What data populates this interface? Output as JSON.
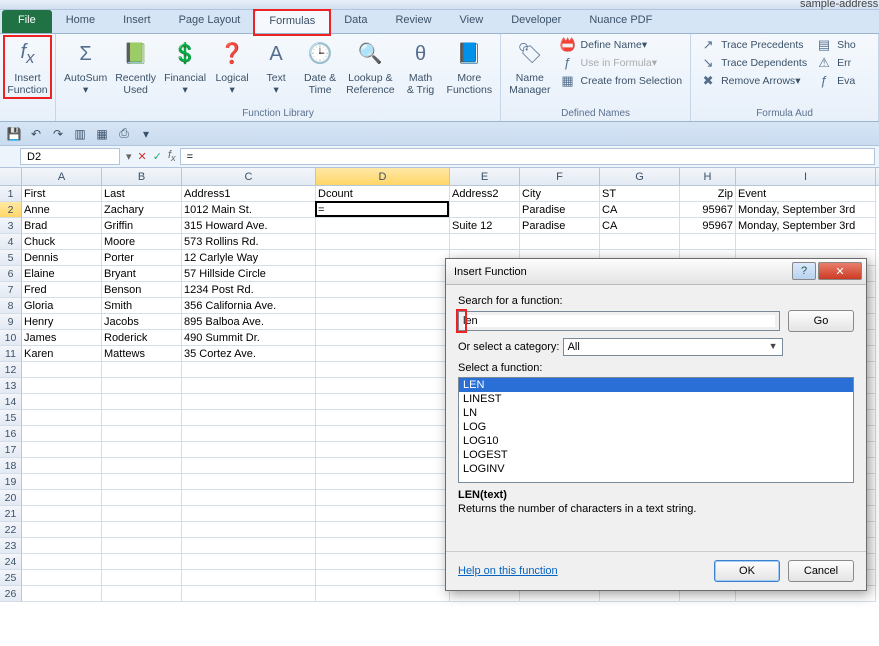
{
  "window": {
    "title": "sample-address"
  },
  "tabs": [
    "File",
    "Home",
    "Insert",
    "Page Layout",
    "Formulas",
    "Data",
    "Review",
    "View",
    "Developer",
    "Nuance PDF"
  ],
  "active_tab": 4,
  "highlight_tab": 4,
  "ribbon": {
    "insert_function": "Insert\nFunction",
    "autosum": "AutoSum",
    "recently": "Recently\nUsed",
    "financial": "Financial",
    "logical": "Logical",
    "text": "Text",
    "date": "Date &\nTime",
    "lookup": "Lookup &\nReference",
    "math": "Math\n& Trig",
    "more": "More\nFunctions",
    "flib": "Function Library",
    "name_mgr": "Name\nManager",
    "def_name": "Define Name",
    "use_form": "Use in Formula",
    "create_sel": "Create from Selection",
    "def_names": "Defined Names",
    "trace_prec": "Trace Precedents",
    "trace_dep": "Trace Dependents",
    "remove_arr": "Remove Arrows",
    "show": "Sho",
    "err": "Err",
    "eval": "Eva",
    "faud": "Formula Aud"
  },
  "namebox": "D2",
  "formula": "=",
  "cols": [
    "A",
    "B",
    "C",
    "D",
    "E",
    "F",
    "G",
    "H",
    "I"
  ],
  "headers": [
    "First",
    "Last",
    "Address1",
    "Dcount",
    "Address2",
    "City",
    "ST",
    "Zip",
    "Event"
  ],
  "rows": [
    [
      "Anne",
      "Zachary",
      "1012 Main St.",
      "=",
      "",
      "Paradise",
      "CA",
      "95967",
      "Monday, September 3rd"
    ],
    [
      "Brad",
      "Griffin",
      "315 Howard Ave.",
      "",
      "Suite 12",
      "Paradise",
      "CA",
      "95967",
      "Monday, September 3rd"
    ],
    [
      "Chuck",
      "Moore",
      "573 Rollins Rd.",
      "",
      "",
      "",
      "",
      "",
      ""
    ],
    [
      "Dennis",
      "Porter",
      "12 Carlyle Way",
      "",
      "",
      "",
      "",
      "",
      ""
    ],
    [
      "Elaine",
      "Bryant",
      "57 Hillside Circle",
      "",
      "",
      "",
      "",
      "",
      ""
    ],
    [
      "Fred",
      "Benson",
      "1234 Post Rd.",
      "",
      "",
      "",
      "",
      "",
      ""
    ],
    [
      "Gloria",
      "Smith",
      "356 California Ave.",
      "",
      "",
      "",
      "",
      "",
      ""
    ],
    [
      "Henry",
      "Jacobs",
      "895 Balboa Ave.",
      "",
      "",
      "",
      "",
      "",
      ""
    ],
    [
      "James",
      "Roderick",
      "490 Summit Dr.",
      "",
      "",
      "",
      "",
      "",
      ""
    ],
    [
      "Karen",
      "Mattews",
      "35 Cortez Ave.",
      "",
      "",
      "",
      "",
      "",
      ""
    ]
  ],
  "blank_rows": 15,
  "active": {
    "row": 2,
    "col": "D"
  },
  "dialog": {
    "title": "Insert Function",
    "search_label": "Search for a function:",
    "search_value": "len",
    "go": "Go",
    "cat_label": "Or select a category:",
    "cat_value": "All",
    "sel_label": "Select a function:",
    "funcs": [
      "LEN",
      "LINEST",
      "LN",
      "LOG",
      "LOG10",
      "LOGEST",
      "LOGINV"
    ],
    "selected_func": 0,
    "syntax": "LEN(text)",
    "desc": "Returns the number of characters in a text string.",
    "help": "Help on this function",
    "ok": "OK",
    "cancel": "Cancel"
  }
}
